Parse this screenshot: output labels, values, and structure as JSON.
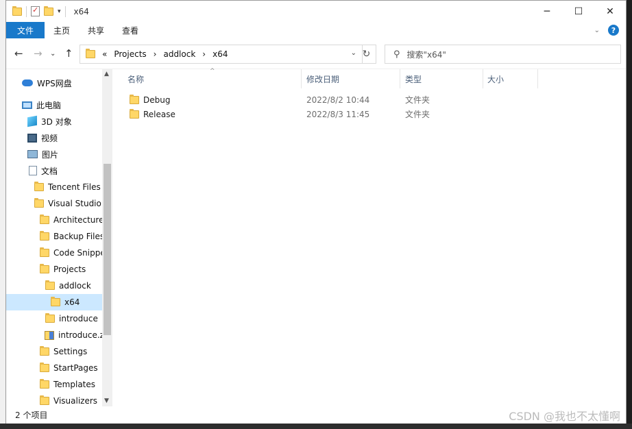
{
  "window": {
    "title": "x64",
    "controls": {
      "minimize": "─",
      "maximize": "☐",
      "close": "✕"
    }
  },
  "ribbon": {
    "tabs": [
      "文件",
      "主页",
      "共享",
      "查看"
    ]
  },
  "address": {
    "crumbs": [
      "«",
      "Projects",
      "›",
      "addlock",
      "›",
      "x64"
    ]
  },
  "search": {
    "placeholder": "搜索\"x64\""
  },
  "nav": {
    "items": [
      {
        "label": "WPS网盘",
        "icon": "cloud-icon"
      },
      {
        "label": "此电脑",
        "icon": "computer-icon"
      },
      {
        "label": "3D 对象",
        "icon": "3d-objects-icon"
      },
      {
        "label": "视频",
        "icon": "video-icon"
      },
      {
        "label": "图片",
        "icon": "pictures-icon"
      },
      {
        "label": "文档",
        "icon": "documents-icon"
      },
      {
        "label": "Tencent Files",
        "icon": "folder-icon"
      },
      {
        "label": "Visual Studio",
        "icon": "folder-icon"
      },
      {
        "label": "Architecture",
        "icon": "folder-icon"
      },
      {
        "label": "Backup Files",
        "icon": "folder-icon"
      },
      {
        "label": "Code Snippe",
        "icon": "folder-icon"
      },
      {
        "label": "Projects",
        "icon": "folder-icon"
      },
      {
        "label": "addlock",
        "icon": "folder-icon"
      },
      {
        "label": "x64",
        "icon": "folder-icon",
        "selected": true
      },
      {
        "label": "introduce",
        "icon": "folder-icon"
      },
      {
        "label": "introduce.z",
        "icon": "zip-icon"
      },
      {
        "label": "Settings",
        "icon": "folder-icon"
      },
      {
        "label": "StartPages",
        "icon": "folder-icon"
      },
      {
        "label": "Templates",
        "icon": "folder-icon"
      },
      {
        "label": "Visualizers",
        "icon": "folder-icon"
      }
    ]
  },
  "columns": {
    "name": "名称",
    "date": "修改日期",
    "type": "类型",
    "size": "大小"
  },
  "files": [
    {
      "name": "Debug",
      "date": "2022/8/2 10:44",
      "type": "文件夹"
    },
    {
      "name": "Release",
      "date": "2022/8/3 11:45",
      "type": "文件夹"
    }
  ],
  "status": {
    "count": "2 个项目",
    "watermark": "CSDN @我也不太懂啊"
  }
}
